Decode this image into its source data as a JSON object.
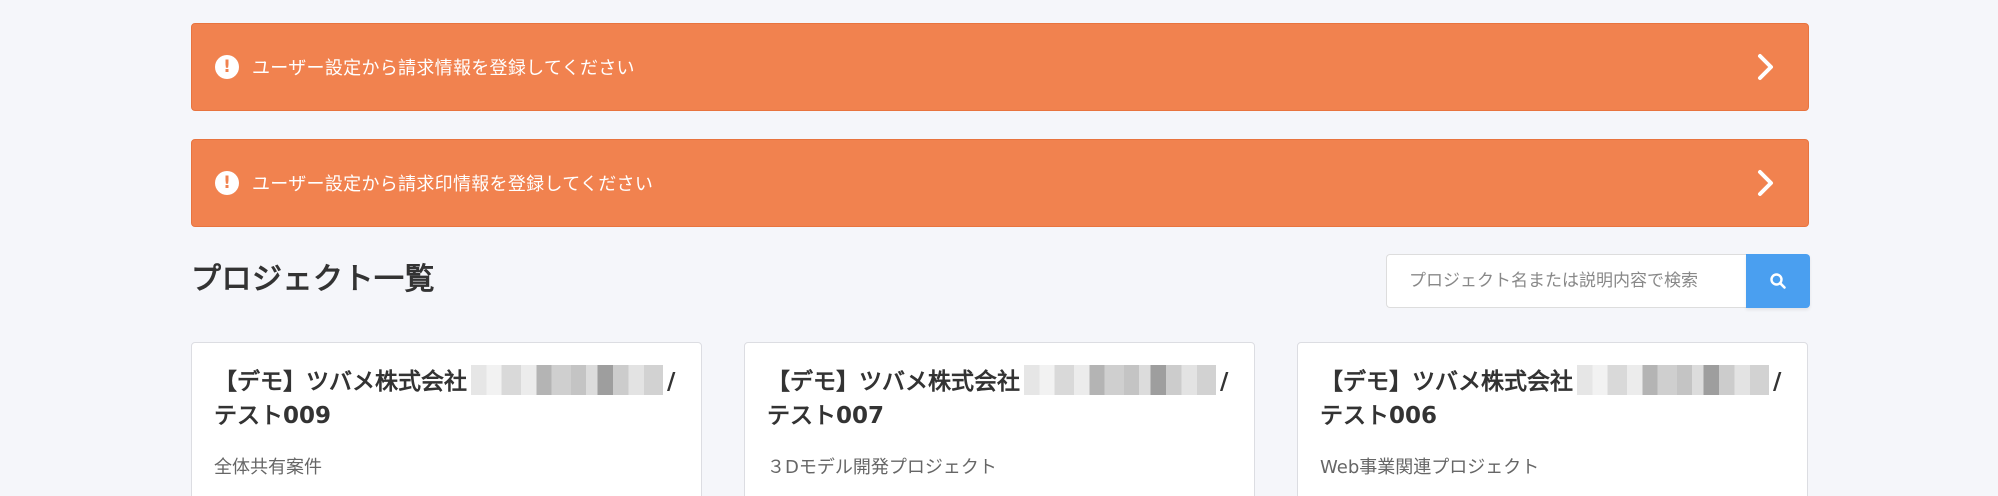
{
  "alerts": [
    {
      "message": "ユーザー設定から請求情報を登録してください",
      "icon": "exclamation-circle-icon"
    },
    {
      "message": "ユーザー設定から請求印情報を登録してください",
      "icon": "exclamation-circle-icon"
    }
  ],
  "page": {
    "title": "プロジェクト一覧"
  },
  "search": {
    "placeholder": "プロジェクト名または説明内容で検索",
    "icon": "search-icon"
  },
  "projects": [
    {
      "title_prefix": "【デモ】ツバメ株式会社",
      "title_suffix": "/ テスト009",
      "description": "全体共有案件"
    },
    {
      "title_prefix": "【デモ】ツバメ株式会社",
      "title_suffix": "/ テスト007",
      "description": "３Dモデル開発プロジェクト"
    },
    {
      "title_prefix": "【デモ】ツバメ株式会社",
      "title_suffix": "/ テスト006",
      "description": "Web事業関連プロジェクト"
    }
  ],
  "colors": {
    "alert": "#f1824f",
    "search_button": "#4a9ff0",
    "background": "#f5f6fa"
  }
}
